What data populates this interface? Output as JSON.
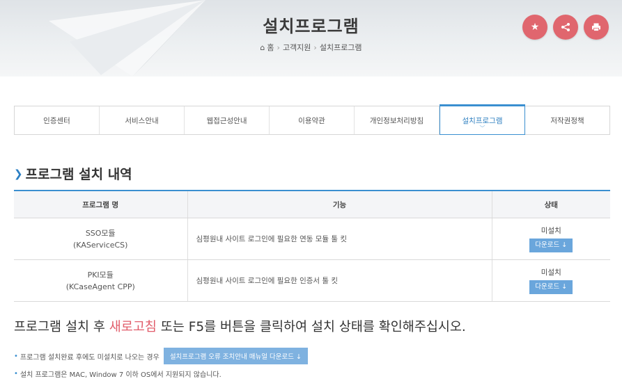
{
  "header": {
    "title": "설치프로그램",
    "breadcrumb": [
      "홈",
      "고객지원",
      "설치프로그램"
    ],
    "action_icons": [
      "star-icon",
      "share-icon",
      "print-icon"
    ],
    "accent_color": "#e0666e"
  },
  "tabs": [
    {
      "label": "인증센터"
    },
    {
      "label": "서비스안내"
    },
    {
      "label": "웹접근성안내"
    },
    {
      "label": "이용약관"
    },
    {
      "label": "개인정보처리방침"
    },
    {
      "label": "설치프로그램",
      "active": true
    },
    {
      "label": "저작권정책"
    }
  ],
  "section": {
    "title": "프로그램 설치 내역"
  },
  "table": {
    "headers": [
      "프로그램 명",
      "기능",
      "상태"
    ],
    "rows": [
      {
        "name": "SSO모듈",
        "sub": "(KAServiceCS)",
        "function": "심평원내 사이트 로그인에 필요한 연동 모듈 툴 킷",
        "status": "미설치",
        "button": "다운로드 ↓"
      },
      {
        "name": "PKI모듈",
        "sub": "(KCaseAgent CPP)",
        "function": "심평원내 사이트 로그인에 필요한 인증서 툴 킷",
        "status": "미설치",
        "button": "다운로드 ↓"
      }
    ]
  },
  "notice": {
    "before": "프로그램 설치 후 ",
    "highlight": "새로고침",
    "after": " 또는 F5를 버튼을 클릭하여 설치 상태를 확인해주십시오.",
    "highlight_color": "#e15c6a"
  },
  "bullets": {
    "b1_text": "프로그램 설치완료 후에도 미설치로 나오는 경우",
    "b1_button": "설치프로그램 오류 조치안내 매뉴얼 다운로드 ↓",
    "b2_text": "설치 프로그램은 MAC, Window 7 이하 OS에서 지원되지 않습니다."
  }
}
